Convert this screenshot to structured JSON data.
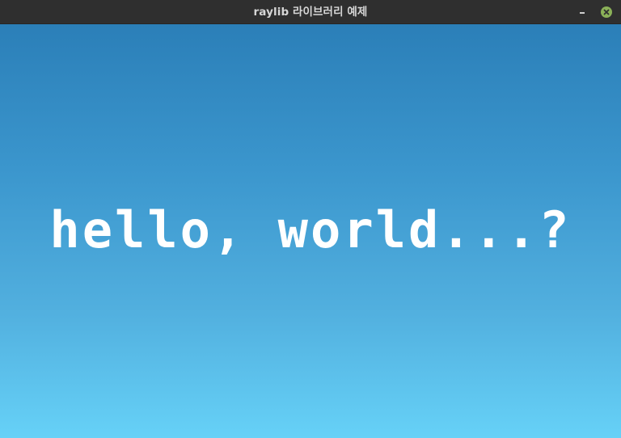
{
  "window": {
    "title": "raylib 라이브러리 예제",
    "controls": {
      "minimize_icon": "minimize-icon",
      "close_icon": "close-icon",
      "close_color": "#8bb158"
    }
  },
  "canvas": {
    "text": "hello, world...?",
    "text_color": "#ffffff",
    "gradient_top": "#2b7fb8",
    "gradient_bottom": "#66d1f7"
  }
}
